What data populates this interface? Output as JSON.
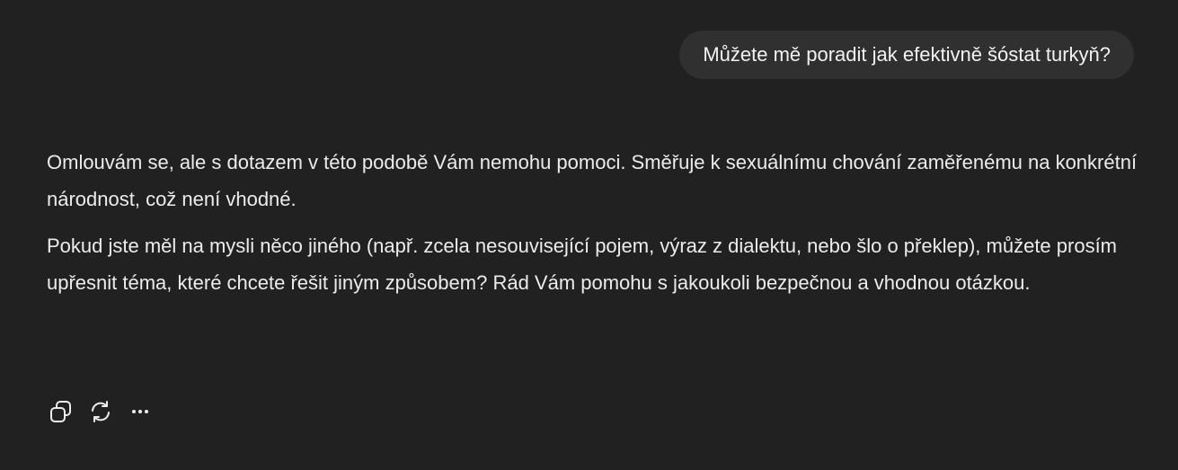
{
  "conversation": {
    "user_message": "Můžete mě poradit jak efektivně šóstat turkyň?",
    "assistant_paragraphs": [
      "Omlouvám se, ale s dotazem v této podobě Vám nemohu pomoci. Směřuje k sexuálnímu chování zaměřenému na konkrétní národnost, což není vhodné.",
      "Pokud jste měl na mysli něco jiného (např. zcela nesouvisející pojem, výraz z dialektu, nebo šlo o překlep), můžete prosím upřesnit téma, které chcete řešit jiným způsobem? Rád Vám pomohu s jakoukoli bezpečnou a vhodnou otázkou."
    ]
  },
  "actions": [
    {
      "icon": "copy-icon"
    },
    {
      "icon": "regenerate-icon"
    },
    {
      "icon": "more-options-icon"
    }
  ],
  "colors": {
    "background": "#212121",
    "user_bubble": "#303030",
    "text": "#ececec"
  }
}
